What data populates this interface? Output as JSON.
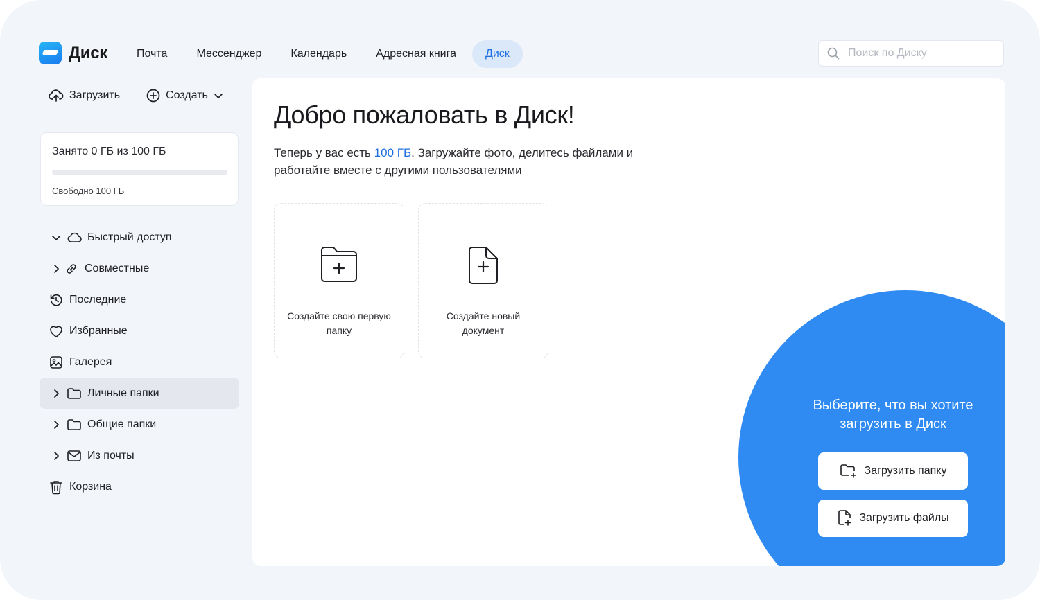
{
  "app": {
    "logo_text": "Диск"
  },
  "nav": {
    "items": [
      {
        "label": "Почта"
      },
      {
        "label": "Мессенджер"
      },
      {
        "label": "Календарь"
      },
      {
        "label": "Адресная книга"
      },
      {
        "label": "Диск",
        "active": true
      }
    ]
  },
  "search": {
    "placeholder": "Поиск по Диску",
    "value": ""
  },
  "sidebar": {
    "upload_label": "Загрузить",
    "create_label": "Создать",
    "storage": {
      "used_text": "Занято 0 ГБ из 100 ГБ",
      "free_text": "Свободно 100 ГБ",
      "used_fraction": 0
    },
    "items": [
      {
        "label": "Быстрый доступ",
        "icon": "cloud-icon",
        "chevron": "down"
      },
      {
        "label": "Совместные",
        "icon": "link-icon",
        "chevron": "right"
      },
      {
        "label": "Последние",
        "icon": "history-icon"
      },
      {
        "label": "Избранные",
        "icon": "heart-icon"
      },
      {
        "label": "Галерея",
        "icon": "gallery-icon"
      },
      {
        "label": "Личные папки",
        "icon": "folder-icon",
        "chevron": "right",
        "selected": true
      },
      {
        "label": "Общие папки",
        "icon": "folder-icon",
        "chevron": "right"
      },
      {
        "label": "Из почты",
        "icon": "mail-icon",
        "chevron": "right"
      },
      {
        "label": "Корзина",
        "icon": "trash-icon"
      }
    ]
  },
  "main": {
    "title": "Добро пожаловать в Диск!",
    "intro_before": "Теперь у вас есть ",
    "intro_highlight": "100 ГБ",
    "intro_after": ". Загружайте фото, делитесь файлами и работайте вместе с другими пользователями",
    "cards": [
      {
        "label": "Создайте свою первую папку",
        "icon": "folder-plus-icon"
      },
      {
        "label": "Создайте новый документ",
        "icon": "document-plus-icon"
      }
    ],
    "upload": {
      "title": "Выберите, что вы хотите загрузить в Диск",
      "folder_button": "Загрузить папку",
      "files_button": "Загрузить файлы"
    }
  },
  "colors": {
    "accent": "#1f6fe0",
    "upload_panel": "#2f8bf2",
    "page_bg": "#f2f5fa"
  }
}
